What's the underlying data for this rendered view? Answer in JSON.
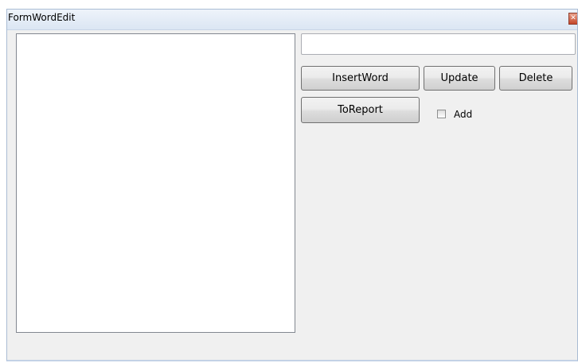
{
  "window": {
    "title": "FormWordEdit",
    "close_glyph": "✕"
  },
  "listbox": {
    "items": []
  },
  "input": {
    "value": "",
    "placeholder": ""
  },
  "buttons": {
    "insert_word": "InsertWord",
    "update": "Update",
    "delete": "Delete",
    "to_report": "ToReport"
  },
  "checkbox": {
    "label": "Add",
    "checked": false
  },
  "icons": {
    "close": "close-icon"
  },
  "colors": {
    "titlebar": "#dbe6f3",
    "client_area": "#f0f0f0",
    "close_button": "#c4472a"
  }
}
